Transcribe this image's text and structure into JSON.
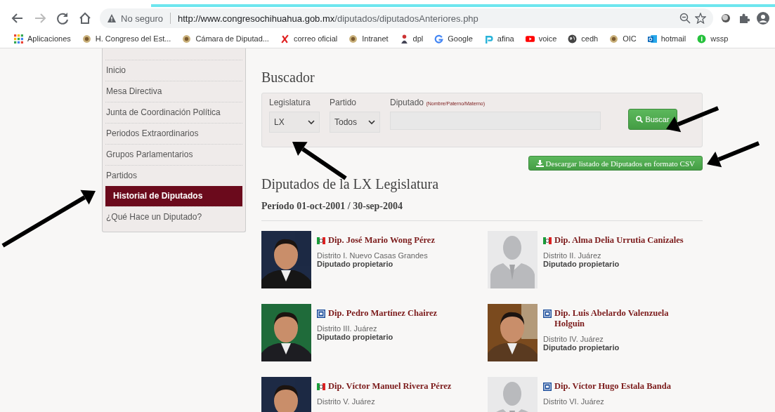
{
  "browser": {
    "security": "No seguro",
    "url_host": "http://www.congresochihuahua.gob.mx",
    "url_path": "/diputados/diputadosAnteriores.php"
  },
  "bookmarks": [
    {
      "label": "Aplicaciones",
      "kind": "apps"
    },
    {
      "label": "H. Congreso del Est...",
      "kind": "seal"
    },
    {
      "label": "Cámara de Diputad...",
      "kind": "seal"
    },
    {
      "label": "correo oficial",
      "kind": "cross"
    },
    {
      "label": "Intranet",
      "kind": "seal"
    },
    {
      "label": "dpl",
      "kind": "figure"
    },
    {
      "label": "Google",
      "kind": "google"
    },
    {
      "label": "afina",
      "kind": "afina"
    },
    {
      "label": "voice",
      "kind": "video"
    },
    {
      "label": "cedh",
      "kind": "globe"
    },
    {
      "label": "OIC",
      "kind": "seal"
    },
    {
      "label": "hotmail",
      "kind": "mail"
    },
    {
      "label": "wssp",
      "kind": "chat"
    }
  ],
  "sidebar": {
    "items": [
      {
        "label": "Inicio",
        "selected": false
      },
      {
        "label": "Mesa Directiva",
        "selected": false
      },
      {
        "label": "Junta de Coordinación Política",
        "selected": false
      },
      {
        "label": "Periodos Extraordinarios",
        "selected": false
      },
      {
        "label": "Grupos Parlamentarios",
        "selected": false
      },
      {
        "label": "Partidos",
        "selected": false
      },
      {
        "label": "Historial de Diputados",
        "selected": true
      },
      {
        "label": "¿Qué Hace un Diputado?",
        "selected": false
      }
    ]
  },
  "search": {
    "title": "Buscador",
    "legislatura_label": "Legislatura",
    "legislatura_value": "LX",
    "partido_label": "Partido",
    "partido_value": "Todos",
    "diputado_label": "Diputado",
    "diputado_hint": "(Nombre/Paterno/Materno)",
    "button": "Buscar"
  },
  "download_button": "Descargar listado de Diputados en formato CSV",
  "results": {
    "title": "Diputados de la LX Legislatura",
    "period": "Período 01-oct-2001 / 30-sep-2004",
    "deputies": [
      {
        "name": "Dip. José Mario Wong Pérez",
        "district": "Distrito I. Nuevo Casas Grandes",
        "role": "Diputado propietario",
        "party_logo": {
          "kind": "tricolor"
        }
      },
      {
        "name": "Dip. Alma Delia Urrutia Canizales",
        "district": "Distrito II. Juárez",
        "role": "Diputado propietario",
        "party_logo": {
          "kind": "tricolor"
        },
        "photo": {
          "kind": "silhouette"
        }
      },
      {
        "name": "Dip. Pedro Martínez Chairez",
        "district": "Distrito III. Juárez",
        "role": "Diputado propietario",
        "party_logo": {
          "kind": "square"
        }
      },
      {
        "name": "Dip. Luis Abelardo Valenzuela Holguin",
        "district": "Distrito IV. Juárez",
        "role": "Diputado propietario",
        "party_logo": {
          "kind": "square"
        }
      },
      {
        "name": "Dip. Víctor Manuel Rivera Pérez",
        "district": "Distrito V. Juárez",
        "party_logo": {
          "kind": "tricolor"
        }
      },
      {
        "name": "Dip. Víctor Hugo Estala Banda",
        "district": "Distrito VI. Juárez",
        "party_logo": {
          "kind": "square"
        },
        "photo": {
          "kind": "silhouette"
        }
      }
    ]
  },
  "annotations": [
    {
      "kind": "arrow"
    },
    {
      "kind": "arrow"
    },
    {
      "kind": "arrow"
    },
    {
      "kind": "arrow"
    }
  ]
}
